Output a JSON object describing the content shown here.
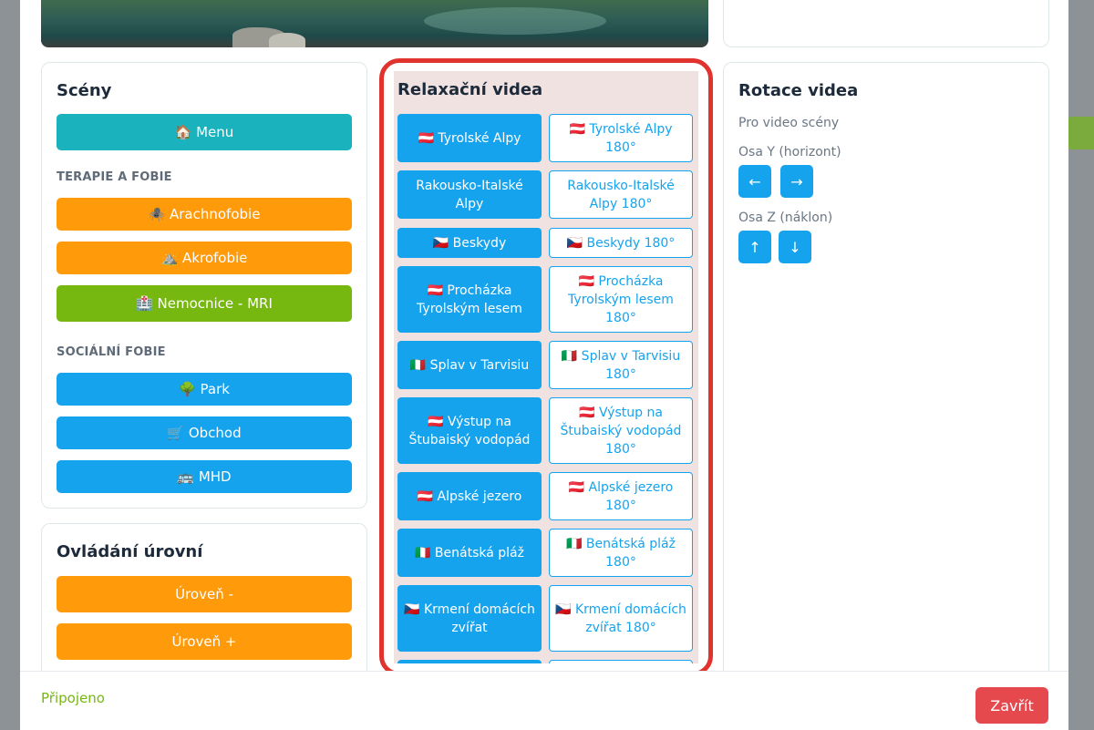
{
  "scenes": {
    "title": "Scény",
    "menu_label": "🏠 Menu",
    "therapy_label": "TERAPIE A FOBIE",
    "therapy_buttons": [
      "🕷️ Arachnofobie",
      "⛰️ Akrofobie",
      "🏥 Nemocnice - MRI"
    ],
    "social_label": "SOCIÁLNÍ FOBIE",
    "social_buttons": [
      "🌳 Park",
      "🛒 Obchod",
      "🚌 MHD"
    ]
  },
  "levels": {
    "title": "Ovládání úrovní",
    "minus_label": "Úroveň -",
    "plus_label": "Úroveň +"
  },
  "videos": {
    "title": "Relaxační videa",
    "rows": [
      [
        "🇦🇹 Tyrolské Alpy",
        "🇦🇹 Tyrolské Alpy 180°"
      ],
      [
        "Rakousko-Italské Alpy",
        "Rakousko-Italské Alpy 180°"
      ],
      [
        "🇨🇿 Beskydy",
        "🇨🇿 Beskydy 180°"
      ],
      [
        "🇦🇹 Procházka Tyrolským lesem",
        "🇦🇹 Procházka Tyrolským lesem 180°"
      ],
      [
        "🇮🇹 Splav v Tarvisiu",
        "🇮🇹 Splav v Tarvisiu 180°"
      ],
      [
        "🇦🇹 Výstup na Štubaiský vodopád",
        "🇦🇹 Výstup na Štubaiský vodopád 180°"
      ],
      [
        "🇦🇹 Alpské jezero",
        "🇦🇹 Alpské jezero 180°"
      ],
      [
        "🇮🇹 Benátská pláž",
        "🇮🇹 Benátská pláž 180°"
      ],
      [
        "🇨🇿 Krmení domácích zvířat",
        "🇨🇿 Krmení domácích zvířat 180°"
      ]
    ]
  },
  "rotation": {
    "title": "Rotace videa",
    "subtitle": "Pro video scény",
    "axis_y": "Osa Y (horizont)",
    "axis_z": "Osa Z (náklon)",
    "left": "←",
    "right": "→",
    "up": "↑",
    "down": "↓"
  },
  "footer": {
    "status": "Připojeno",
    "close": "Zavřít"
  },
  "colors": {
    "accent_blue": "#16a3ee",
    "orange": "#ff9a0a",
    "green": "#76b80f",
    "teal": "#19b2bd",
    "danger": "#e5484d",
    "highlight": "#e0332e"
  }
}
